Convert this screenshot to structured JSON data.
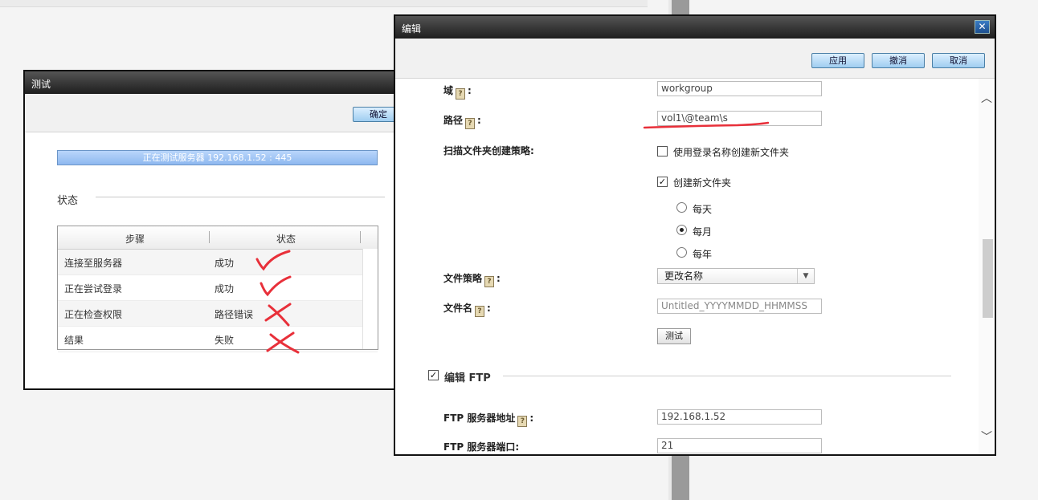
{
  "test_dialog": {
    "title": "测试",
    "ok_label": "确定",
    "progress_text": "正在测试服务器 192.168.1.52 : 445",
    "section_title": "状态",
    "table": {
      "headers": [
        "步骤",
        "状态"
      ],
      "rows": [
        {
          "step": "连接至服务器",
          "status": "成功"
        },
        {
          "step": "正在尝试登录",
          "status": "成功"
        },
        {
          "step": "正在检查权限",
          "status": "路径错误"
        },
        {
          "step": "结果",
          "status": "失败"
        }
      ]
    }
  },
  "edit_dialog": {
    "title": "编辑",
    "close_glyph": "✕",
    "buttons": {
      "apply": "应用",
      "revert": "撤消",
      "cancel": "取消"
    },
    "help_glyph": "?",
    "domain": {
      "label": "域",
      "value": "workgroup"
    },
    "path": {
      "label": "路径",
      "value": "vol1\\@team\\s"
    },
    "scan_policy": {
      "label": "扫描文件夹创建策略:",
      "use_login_name": {
        "label": "使用登录名称创建新文件夹",
        "checked": false
      },
      "create_new_folder": {
        "label": "创建新文件夹",
        "checked": true
      },
      "frequency": [
        {
          "label": "每天",
          "selected": false
        },
        {
          "label": "每月",
          "selected": true
        },
        {
          "label": "每年",
          "selected": false
        }
      ]
    },
    "file_policy": {
      "label": "文件策略",
      "value": "更改名称"
    },
    "file_name": {
      "label": "文件名",
      "placeholder": "Untitled_YYYYMMDD_HHMMSS"
    },
    "test_label": "测试",
    "ftp_section": {
      "label": "编辑 FTP",
      "checked": true
    },
    "ftp_address": {
      "label": "FTP 服务器地址",
      "value": "192.168.1.52"
    },
    "ftp_port": {
      "label": "FTP 服务器端口:",
      "value": "21"
    }
  },
  "annotation_color": "#e8303a"
}
